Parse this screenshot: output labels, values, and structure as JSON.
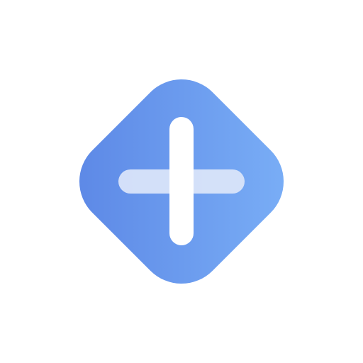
{
  "app_icon": {
    "name": "add-plus-icon",
    "shape": "rounded-diamond",
    "gradient_start": "#5B86E5",
    "gradient_end": "#7BB0F7",
    "vertical_bar_color": "#FFFFFF",
    "horizontal_bar_color": "#DCE6FA",
    "background": "#FFFFFF"
  }
}
